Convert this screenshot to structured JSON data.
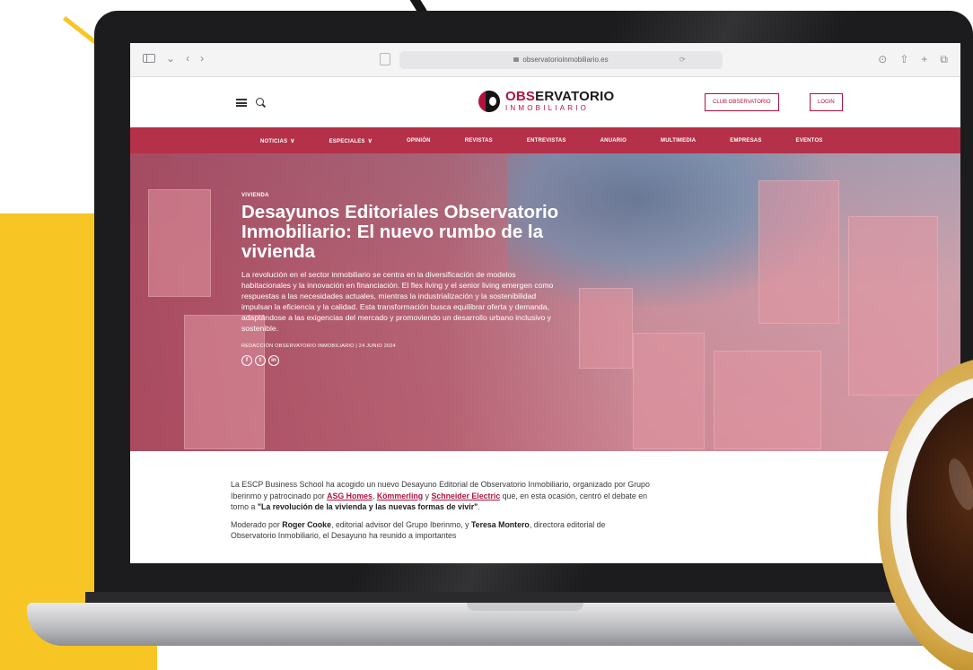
{
  "browser": {
    "url": "observatorioinmobiliario.es"
  },
  "header": {
    "logo_top_accent": "OBS",
    "logo_top_rest": "ERVATORIO",
    "logo_bottom": "INMOBILIARIO",
    "club_button": "CLUB OBSERVATORIO",
    "login_button": "LOGIN"
  },
  "nav": {
    "items": [
      {
        "label": "NOTICIAS",
        "dropdown": true
      },
      {
        "label": "ESPECIALES",
        "dropdown": true
      },
      {
        "label": "OPINIÓN",
        "dropdown": false
      },
      {
        "label": "REVISTAS",
        "dropdown": false
      },
      {
        "label": "ENTREVISTAS",
        "dropdown": false
      },
      {
        "label": "ANUARIO",
        "dropdown": false
      },
      {
        "label": "MULTIMEDIA",
        "dropdown": false
      },
      {
        "label": "EMPRESAS",
        "dropdown": false
      },
      {
        "label": "EVENTOS",
        "dropdown": false
      }
    ],
    "chevron": "∨"
  },
  "hero": {
    "category": "VIVIENDA",
    "title": "Desayunos Editoriales Observatorio Inmobiliario: El nuevo rumbo de la vivienda",
    "summary": "La revolución en el sector inmobiliario se centra en la diversificación de modelos habitacionales y la innovación en financiación. El flex living y el senior living emergen como respuestas a las necesidades actuales, mientras la industrialización y la sostenibilidad impulsan la eficiencia y la calidad. Esta transformación busca equilibrar oferta y demanda, adaptándose a las exigencias del mercado y promoviendo un desarrollo urbano inclusivo y sostenible.",
    "byline": "REDACCIÓN OBSERVATORIO INMOBILIARIO | 24 JUNIO 2024",
    "social": [
      "f",
      "t",
      "in"
    ]
  },
  "article": {
    "p1_intro": "La ESCP Business School ha acogido un nuevo Desayuno Editorial de Observatorio Inmobiliario, organizado por Grupo Iberinmo y patrocinado por ",
    "link_asg": "ASG Homes",
    "p1_comma": ", ",
    "link_kommerling": "Kömmerling",
    "p1_y": " y ",
    "link_schneider": "Schneider Electric",
    "p1_middle": " que, en esta ocasión, centró el debate en torno a ",
    "p1_quote": "\"La revolución de la vivienda y las nuevas formas de vivir\"",
    "p1_end": ".",
    "p2_start": "Moderado por ",
    "p2_name1": "Roger Cooke",
    "p2_mid": ", editorial advisor del Grupo Iberinmo, y ",
    "p2_name2": "Teresa Montero",
    "p2_end": ", directora editorial de Observatorio Inmobiliario, el Desayuno ha reunido a importantes"
  }
}
